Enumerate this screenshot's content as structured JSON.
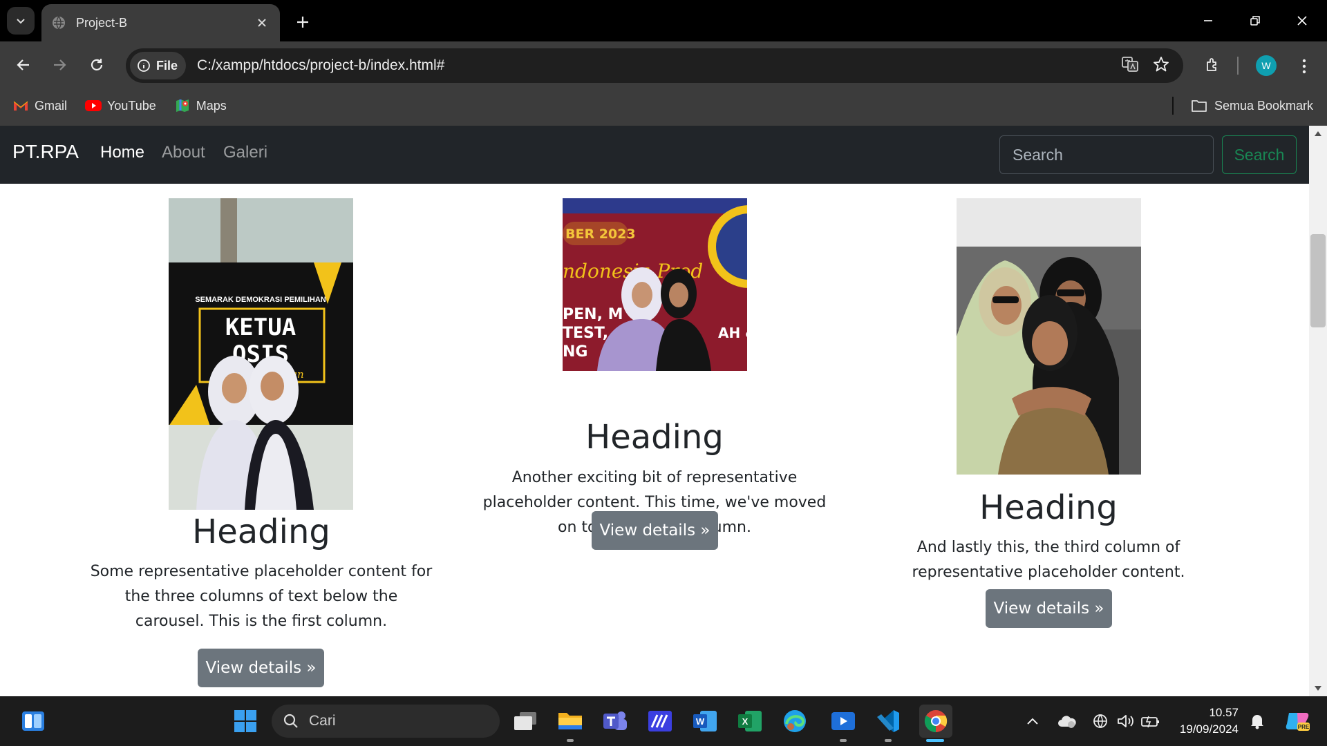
{
  "browser": {
    "tab_title": "Project-B",
    "url": "C:/xampp/htdocs/project-b/index.html#",
    "url_chip": "File",
    "profile_initial": "W",
    "bookmarks": [
      {
        "label": "Gmail",
        "icon": "gmail-icon"
      },
      {
        "label": "YouTube",
        "icon": "youtube-icon"
      },
      {
        "label": "Maps",
        "icon": "maps-icon"
      }
    ],
    "all_bookmarks": "Semua Bookmark"
  },
  "page": {
    "brand": "PT.RPA",
    "nav": [
      "Home",
      "About",
      "Galeri"
    ],
    "search_placeholder": "Search",
    "search_button": "Search",
    "columns": [
      {
        "heading": "Heading",
        "text": "Some representative placeholder content for the three columns of text below the carousel. This is the first column.",
        "button": "View details »",
        "photo_caption": "SEMARAK DEMOKRASI PEMILIHAN KETUA OSIS"
      },
      {
        "heading": "Heading",
        "text": "Another exciting bit of representative placeholder content. This time, we've moved on to the second column.",
        "button": "View details »",
        "photo_caption": "BER 2023"
      },
      {
        "heading": "Heading",
        "text": "And lastly this, the third column of representative placeholder content.",
        "button": "View details »"
      }
    ]
  },
  "taskbar": {
    "search_placeholder": "Cari",
    "time": "10.57",
    "date": "19/09/2024"
  },
  "colors": {
    "navbar": "#212529",
    "success": "#198754",
    "secondary": "#6c757d"
  }
}
